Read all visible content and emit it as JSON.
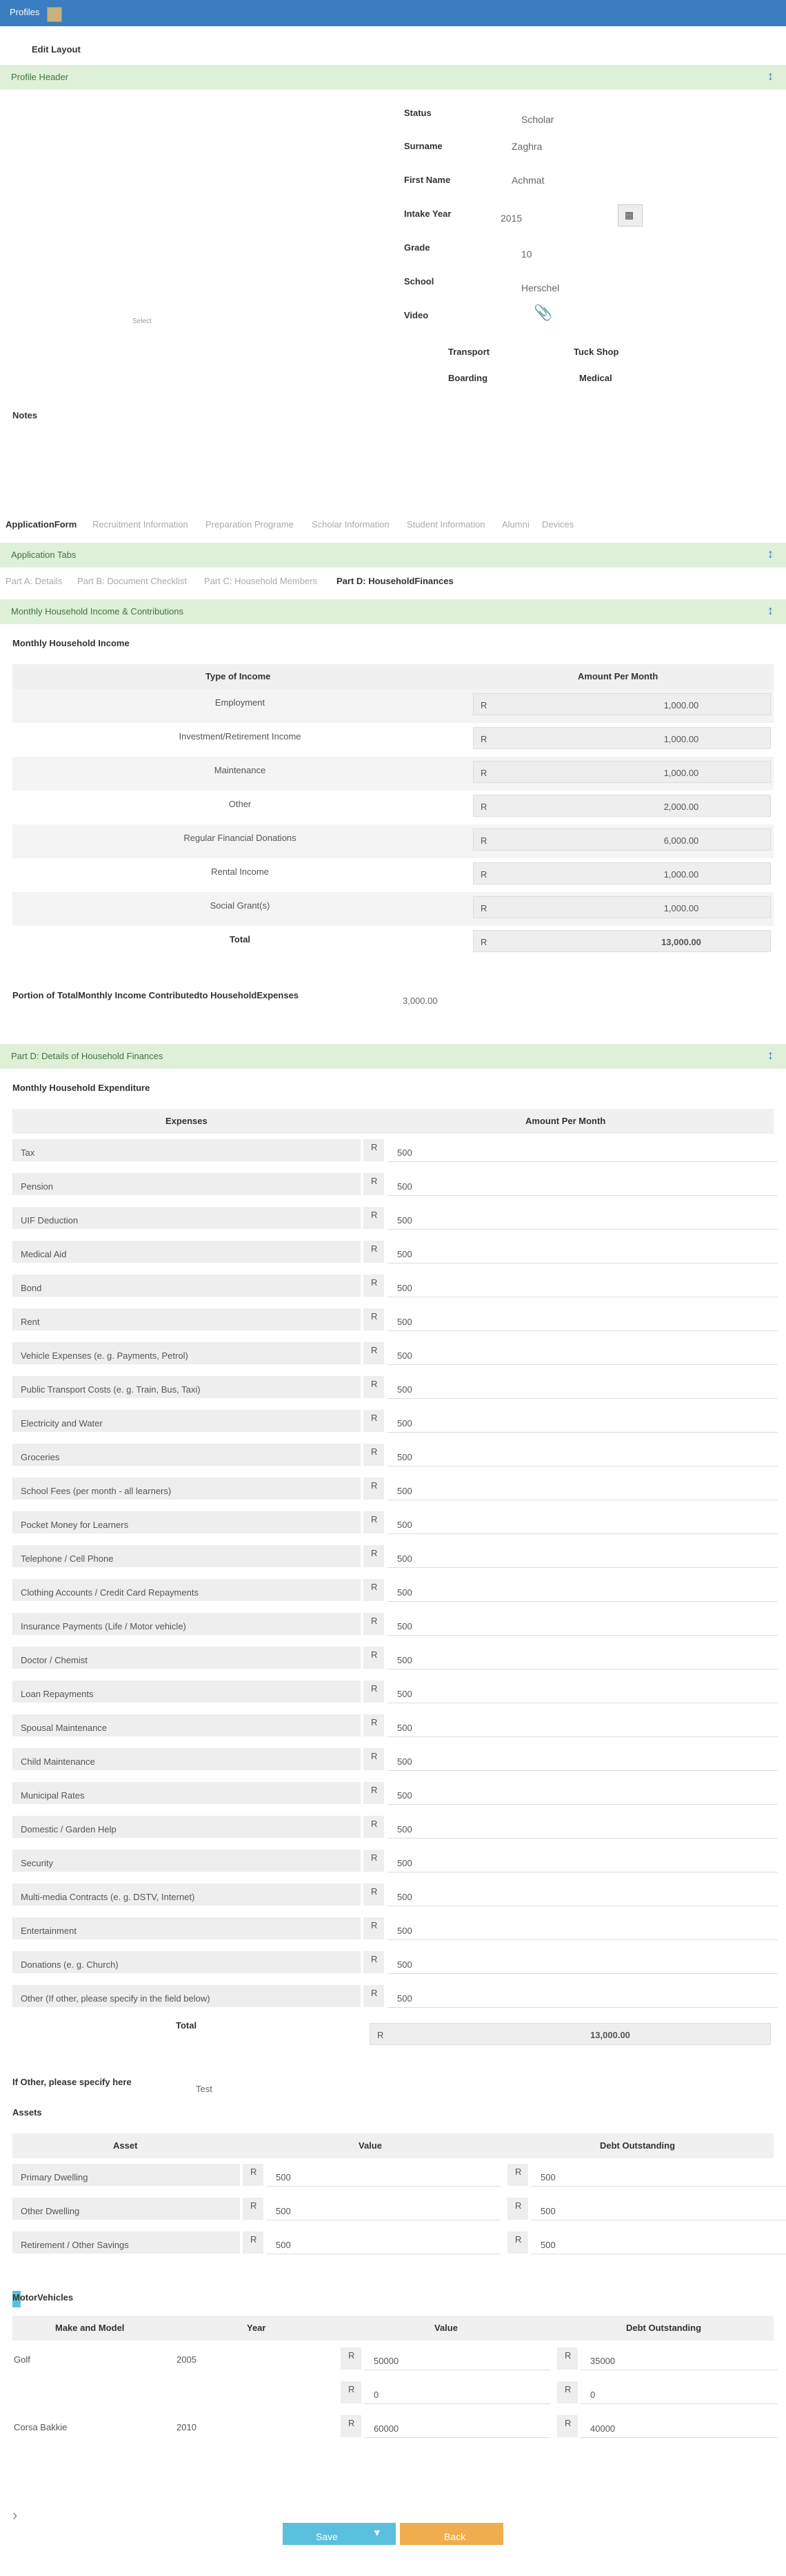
{
  "topbar": {
    "title": "Profiles"
  },
  "edit_layout": "Edit Layout",
  "profile_header": {
    "title": "Profile Header"
  },
  "profile": {
    "select_label": "Select",
    "fields": [
      {
        "label": "Status",
        "value": "Scholar"
      },
      {
        "label": "Surname",
        "value": "Zaghra"
      },
      {
        "label": "First Name",
        "value": "Achmat"
      },
      {
        "label": "Intake Year",
        "value": "2015"
      },
      {
        "label": "Grade",
        "value": "10"
      },
      {
        "label": "School",
        "value": "Herschel"
      },
      {
        "label": "Video",
        "value": ""
      }
    ],
    "flags": [
      "Transport",
      "Tuck Shop",
      "Boarding",
      "Medical"
    ]
  },
  "notes_label": "Notes",
  "main_tabs": [
    "ApplicationForm",
    "Recruitment Information",
    "Preparation Programe",
    "Scholar Information",
    "Student Information",
    "Alumni",
    "Devices"
  ],
  "application_tabs": {
    "title": "Application Tabs"
  },
  "sub_tabs": [
    "Part A: Details",
    "Part B: Document Checklist",
    "Part C: Household Members",
    "Part D: HouseholdFinances"
  ],
  "income_section": {
    "title": "Monthly Household Income & Contributions",
    "subtitle": "Monthly Household Income",
    "col_type": "Type of Income",
    "col_amount": "Amount Per Month",
    "currency": "R",
    "rows": [
      {
        "type": "Employment",
        "amount": "1,000.00"
      },
      {
        "type": "Investment/Retirement Income",
        "amount": "1,000.00"
      },
      {
        "type": "Maintenance",
        "amount": "1,000.00"
      },
      {
        "type": "Other",
        "amount": "2,000.00"
      },
      {
        "type": "Regular Financial Donations",
        "amount": "6,000.00"
      },
      {
        "type": "Rental Income",
        "amount": "1,000.00"
      },
      {
        "type": "Social Grant(s)",
        "amount": "1,000.00"
      }
    ],
    "total_label": "Total",
    "total": "13,000.00",
    "portion_label": "Portion of TotalMonthly Income Contributedto HouseholdExpenses",
    "portion_value": "3,000.00"
  },
  "finances_section": {
    "title": "Part D: Details of Household Finances",
    "subtitle": "Monthly Household Expenditure",
    "col_expenses": "Expenses",
    "col_amount": "Amount Per Month",
    "currency": "R",
    "expenses": [
      {
        "label": "Tax",
        "value": "500"
      },
      {
        "label": "Pension",
        "value": "500"
      },
      {
        "label": "UIF Deduction",
        "value": "500"
      },
      {
        "label": "Medical Aid",
        "value": "500"
      },
      {
        "label": "Bond",
        "value": "500"
      },
      {
        "label": "Rent",
        "value": "500"
      },
      {
        "label": "Vehicle Expenses (e. g. Payments, Petrol)",
        "value": "500"
      },
      {
        "label": "Public Transport Costs (e. g. Train, Bus, Taxi)",
        "value": "500"
      },
      {
        "label": "Electricity and Water",
        "value": "500"
      },
      {
        "label": "Groceries",
        "value": "500"
      },
      {
        "label": "School Fees (per month - all learners)",
        "value": "500"
      },
      {
        "label": "Pocket Money for Learners",
        "value": "500"
      },
      {
        "label": "Telephone / Cell Phone",
        "value": "500"
      },
      {
        "label": "Clothing Accounts / Credit Card Repayments",
        "value": "500"
      },
      {
        "label": "Insurance Payments (Life / Motor vehicle)",
        "value": "500"
      },
      {
        "label": "Doctor / Chemist",
        "value": "500"
      },
      {
        "label": "Loan Repayments",
        "value": "500"
      },
      {
        "label": "Spousal Maintenance",
        "value": "500"
      },
      {
        "label": "Child Maintenance",
        "value": "500"
      },
      {
        "label": "Municipal Rates",
        "value": "500"
      },
      {
        "label": "Domestic / Garden Help",
        "value": "500"
      },
      {
        "label": "Security",
        "value": "500"
      },
      {
        "label": "Multi-media Contracts (e. g. DSTV, Internet)",
        "value": "500"
      },
      {
        "label": "Entertainment",
        "value": "500"
      },
      {
        "label": "Donations (e. g. Church)",
        "value": "500"
      },
      {
        "label": "Other (If other, please specify in the field below)",
        "value": "500"
      }
    ],
    "total_label": "Total",
    "total": "13,000.00",
    "other_label": "If Other, please specify here",
    "other_value": "Test"
  },
  "assets": {
    "title": "Assets",
    "col_asset": "Asset",
    "col_value": "Value",
    "col_debt": "Debt Outstanding",
    "rows": [
      {
        "asset": "Primary Dwelling",
        "value": "500",
        "debt": "500"
      },
      {
        "asset": "Other Dwelling",
        "value": "500",
        "debt": "500"
      },
      {
        "asset": "Retirement / Other Savings",
        "value": "500",
        "debt": "500"
      }
    ]
  },
  "vehicles": {
    "title": "MotorVehicles",
    "col_make": "Make and Model",
    "col_year": "Year",
    "col_value": "Value",
    "col_debt": "Debt Outstanding",
    "rows": [
      {
        "make": "Golf",
        "year": "2005",
        "value": "50000",
        "debt": "35000"
      },
      {
        "make": "",
        "year": "",
        "value": "0",
        "debt": "0"
      },
      {
        "make": "Corsa Bakkie",
        "year": "2010",
        "value": "60000",
        "debt": "40000"
      }
    ]
  },
  "buttons": {
    "save": "Save",
    "back": "Back"
  },
  "colors": {
    "topbar": "#3a7dc0",
    "section": "#dff0d8",
    "save": "#5bc0de",
    "back": "#f0ad4e"
  }
}
